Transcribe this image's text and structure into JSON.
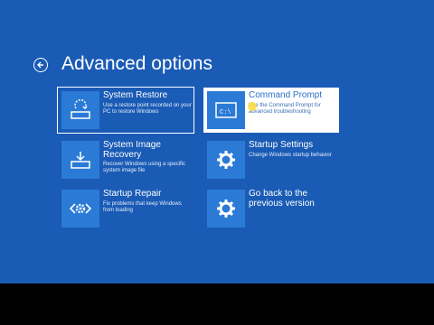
{
  "header": {
    "title": "Advanced options",
    "back_icon": "back-arrow-icon"
  },
  "tiles": [
    {
      "name": "System Restore",
      "desc": "Use a restore point recorded on your PC to restore Windows",
      "icon": "system-restore-icon"
    },
    {
      "name": "Command Prompt",
      "desc": "Use the Command Prompt for advanced troubleshooting",
      "icon": "command-prompt-icon",
      "icon_text": "C:\\"
    },
    {
      "name": "System Image Recovery",
      "desc": "Recover Windows using a specific system image file",
      "icon": "system-image-icon"
    },
    {
      "name": "Startup Settings",
      "desc": "Change Windows startup behavior",
      "icon": "gear-icon"
    },
    {
      "name": "Startup Repair",
      "desc": "Fix problems that keep Windows from loading",
      "icon": "startup-repair-icon"
    },
    {
      "name": "Go back to the previous version",
      "desc": "",
      "icon": "gear-icon"
    }
  ],
  "colors": {
    "background": "#1a5bb5",
    "tile_icon": "#2a7ad6",
    "highlight": "#ffffff",
    "text": "#ffffff"
  }
}
